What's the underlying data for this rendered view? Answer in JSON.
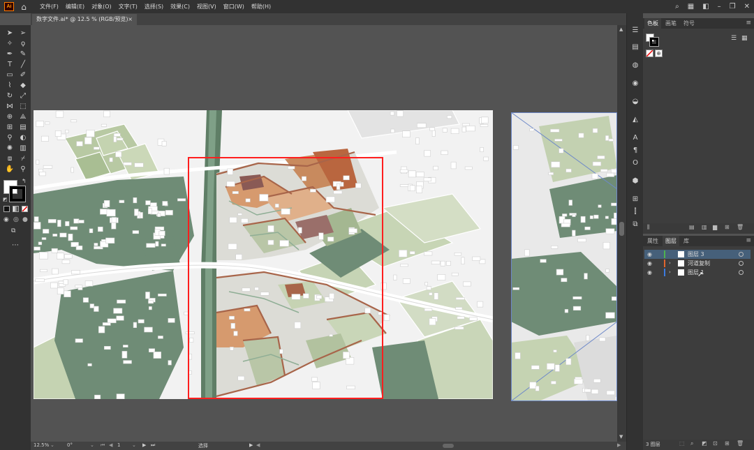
{
  "app": {
    "logo": "Ai",
    "home_icon": "home-icon"
  },
  "menu": [
    "文件(F)",
    "编辑(E)",
    "对象(O)",
    "文字(T)",
    "选择(S)",
    "效果(C)",
    "视图(V)",
    "窗口(W)",
    "帮助(H)"
  ],
  "document_tab": {
    "title": "数字文件.ai* @ 12.5 % (RGB/预览)",
    "close": "×"
  },
  "status": {
    "zoom": "12.5%",
    "rotation": "0°",
    "artboard": "1",
    "tool": "选择"
  },
  "panel_top": {
    "tabs": [
      "色板",
      "画笔",
      "符号"
    ],
    "active": "色板"
  },
  "panel_layers": {
    "tabs": [
      "属性",
      "图层",
      "库"
    ],
    "active": "图层",
    "layers": [
      {
        "name": "图层 3",
        "color": "#4fb24f",
        "selected": true
      },
      {
        "name": "河道复制",
        "color": "#e0652e",
        "selected": false
      },
      {
        "name": "图层 1",
        "color": "#3b7be0",
        "selected": false
      }
    ],
    "footer": "3 图层"
  },
  "colors": {
    "accent_selection": "#ff1e1e",
    "map_green": "#6f8c76",
    "map_orange": "#c98b62",
    "map_brown": "#a8654a"
  }
}
